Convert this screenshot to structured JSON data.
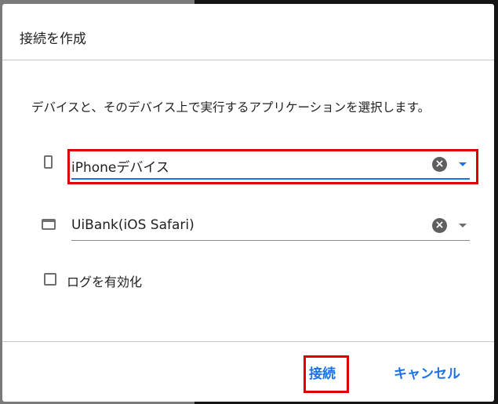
{
  "dialog": {
    "title": "接続を作成",
    "description": "デバイスと、そのデバイス上で実行するアプリケーションを選択します。"
  },
  "device_field": {
    "value": "iPhoneデバイス",
    "icon": "phone-icon",
    "clear_icon": "clear-icon",
    "dropdown_icon": "dropdown-arrow-icon",
    "clear_glyph": "×"
  },
  "app_field": {
    "value": "UiBank(iOS Safari)",
    "icon": "window-icon",
    "clear_icon": "clear-icon",
    "dropdown_icon": "dropdown-arrow-icon",
    "clear_glyph": "×"
  },
  "log_option": {
    "label": "ログを有効化",
    "checked": false
  },
  "buttons": {
    "connect_label": "接続",
    "cancel_label": "キャンセル"
  },
  "colors": {
    "accent": "#1a73e8",
    "highlight": "#e00000"
  }
}
